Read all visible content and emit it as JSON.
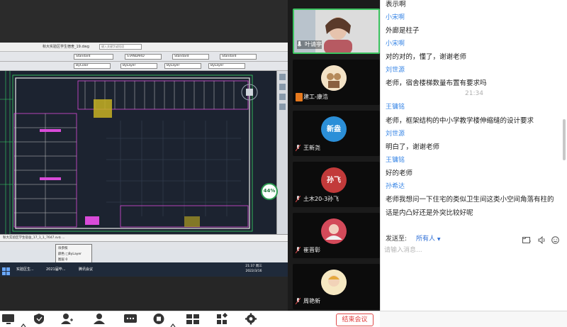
{
  "cad": {
    "file_title": "秋大实验区学生宿舍_19.dwg",
    "search_placeholder": "键入关键字或短语",
    "toolbar": {
      "style1": "Standard",
      "style2": "STANDARD",
      "style3": "Standard",
      "style4": "Standard",
      "layer": "ByLayer",
      "linetype": "ByLayer",
      "lineweight": "ByLayer",
      "color": "ByColor"
    },
    "command_line": "秋大实验区学生宿舍_17_1_1_7647.sv$ ...",
    "property_popup": {
      "title": "块参照",
      "rows": [
        "颜色  □ByLayer",
        "图层  0",
        "线型  ByLayer"
      ]
    },
    "zoom": "44%",
    "zoom_sub": "+0°C"
  },
  "taskbar": {
    "items": [
      "实验区生...",
      "2021届毕...",
      "腾讯会议"
    ],
    "time": "21:37 周三",
    "date": "2022/3/16"
  },
  "participants": [
    {
      "name": "叶请亭",
      "active": true,
      "mic": true,
      "host": false
    },
    {
      "name": "建工-康浩",
      "active": false,
      "mic": false,
      "host": true
    },
    {
      "name": "王新尧",
      "active": false,
      "mic": false,
      "host": false
    },
    {
      "name": "土木20-3孙飞",
      "active": false,
      "mic": false,
      "host": false
    },
    {
      "name": "崔晋彰",
      "active": false,
      "mic": false,
      "host": false
    },
    {
      "name": "周艳新",
      "active": false,
      "mic": false,
      "host": false
    }
  ],
  "avatar_texts": {
    "p3": "新盎",
    "p4": "孙飞"
  },
  "chat": {
    "messages": [
      {
        "type": "text",
        "text": "表示啊"
      },
      {
        "type": "name",
        "text": "小宋啊"
      },
      {
        "type": "text",
        "text": "外廊是柱子"
      },
      {
        "type": "name",
        "text": "小宋啊"
      },
      {
        "type": "text",
        "text": "对的对的，懂了，谢谢老师"
      },
      {
        "type": "name",
        "text": "刘世源"
      },
      {
        "type": "text",
        "text": "老师，宿舍楼梯数量布置有要求吗"
      },
      {
        "type": "time",
        "text": "21:34"
      },
      {
        "type": "name",
        "text": "王镛铭"
      },
      {
        "type": "text",
        "text": "老师，框架结构的中小学教学楼伸缩缝的设计要求"
      },
      {
        "type": "name",
        "text": "刘世源"
      },
      {
        "type": "text",
        "text": "明白了，谢谢老师"
      },
      {
        "type": "name",
        "text": "王镛铭"
      },
      {
        "type": "text",
        "text": "好的老师"
      },
      {
        "type": "name",
        "text": "孙希达"
      },
      {
        "type": "text",
        "text": "老师我想问一下住宅的类似卫生间这类小空间角落有柱的"
      },
      {
        "type": "text",
        "text": "话是内凸好还是外突比较好呢"
      }
    ],
    "send_label": "发送至:",
    "send_target": "所有人",
    "input_placeholder": "请输入消息..."
  },
  "bottombar": {
    "end_label": "结束会议"
  },
  "colors": {
    "accent_green": "#3cc460",
    "name_blue": "#3a87e6",
    "end_red": "#e03a3a"
  }
}
